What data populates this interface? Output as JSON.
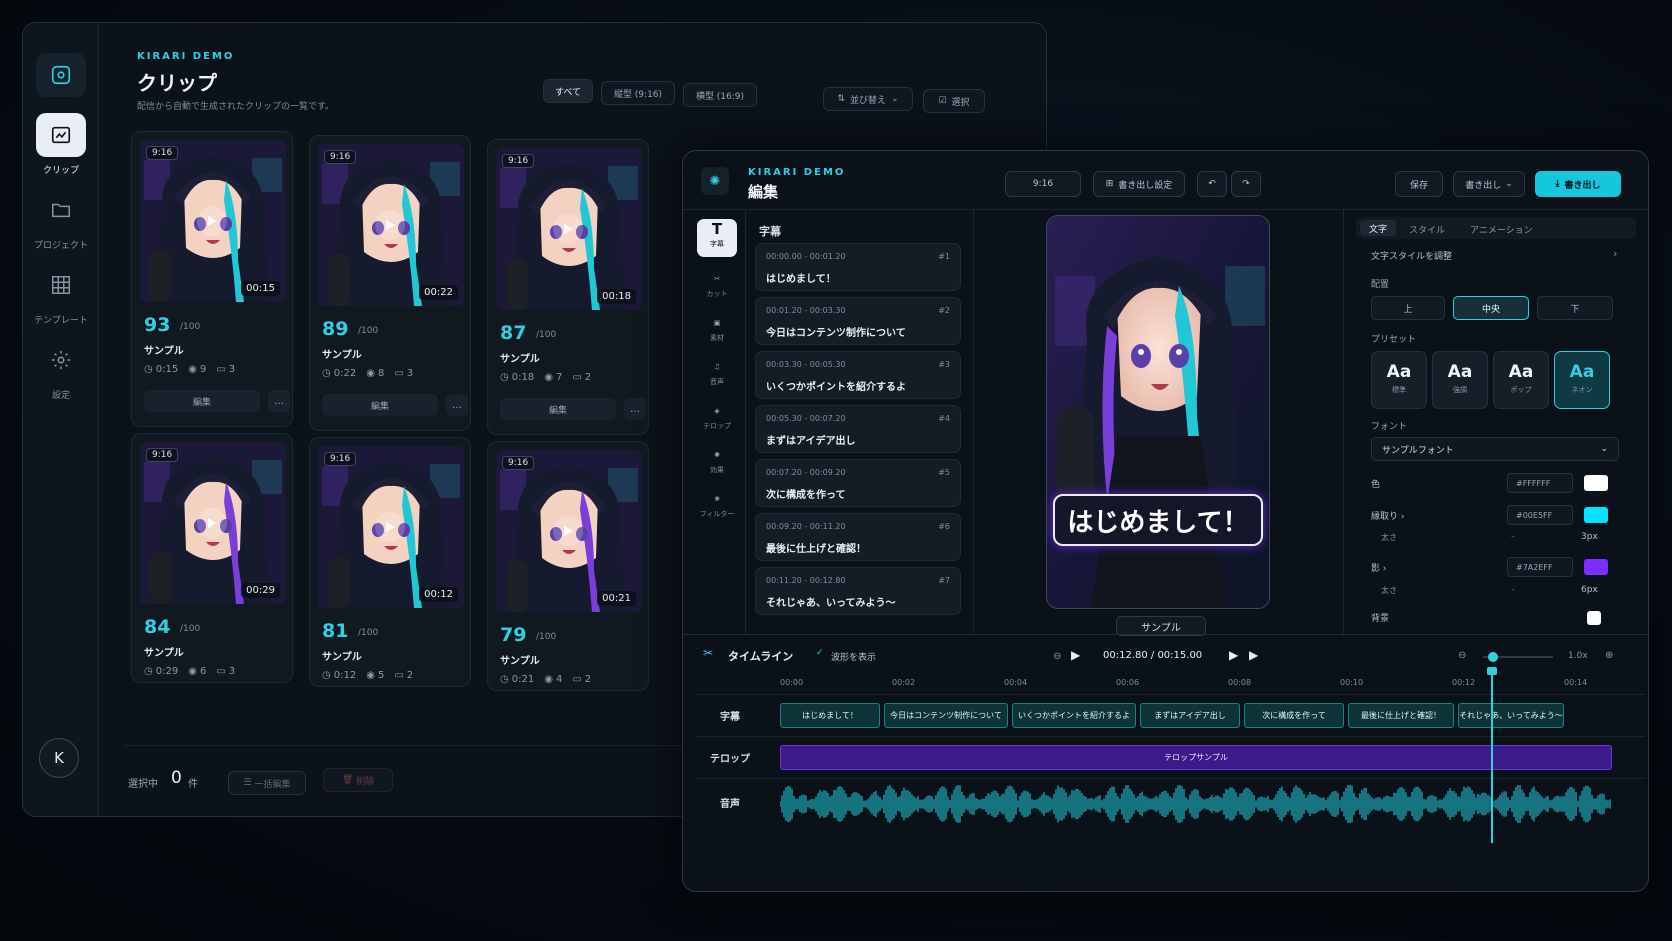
{
  "clips_window": {
    "brand": "KIRARI DEMO",
    "title": "クリップ",
    "subtitle": "配信から自動で生成されたクリップの一覧です。",
    "nav": [
      {
        "label": "クリップ",
        "icon": "clip-icon"
      },
      {
        "label": "プロジェクト",
        "icon": "folder-icon"
      },
      {
        "label": "テンプレート",
        "icon": "grid-icon"
      },
      {
        "label": "設定",
        "icon": "gear-icon"
      }
    ],
    "avatar": "K",
    "filters": [
      "すべて",
      "縦型 (9:16)",
      "横型 (16:9)"
    ],
    "sort_label": "並び替え",
    "select_label": "選択",
    "cards": [
      {
        "ratio": "9:16",
        "duration": "00:15",
        "score": "93",
        "max": "/100",
        "title": "サンプル",
        "time": "0:15",
        "views": "9",
        "comments": "3",
        "edit": "編集",
        "more": "…"
      },
      {
        "ratio": "9:16",
        "duration": "00:22",
        "score": "89",
        "max": "/100",
        "title": "サンプル",
        "time": "0:22",
        "views": "8",
        "comments": "3",
        "edit": "編集",
        "more": "…"
      },
      {
        "ratio": "9:16",
        "duration": "00:18",
        "score": "87",
        "max": "/100",
        "title": "サンプル",
        "time": "0:18",
        "views": "7",
        "comments": "2",
        "edit": "編集",
        "more": "…"
      },
      {
        "ratio": "9:16",
        "duration": "00:29",
        "score": "84",
        "max": "/100",
        "title": "サンプル",
        "time": "0:29",
        "views": "6",
        "comments": "3"
      },
      {
        "ratio": "9:16",
        "duration": "00:12",
        "score": "81",
        "max": "/100",
        "title": "サンプル",
        "time": "0:12",
        "views": "5",
        "comments": "2"
      },
      {
        "ratio": "9:16",
        "duration": "00:21",
        "score": "79",
        "max": "/100",
        "title": "サンプル",
        "time": "0:21",
        "views": "4",
        "comments": "2"
      }
    ],
    "footer": {
      "selected_label": "選択中",
      "count": "0",
      "unit": "件",
      "bulk_edit": "一括編集",
      "delete": "削除"
    }
  },
  "edit_window": {
    "brand": "KIRARI DEMO",
    "title": "編集",
    "ratio": "9:16",
    "export_settings": "書き出し設定",
    "save": "保存",
    "export_menu": "書き出し",
    "export_button": "書き出し",
    "tools": [
      {
        "label": "字幕",
        "icon": "text-icon"
      },
      {
        "label": "カット",
        "icon": "scissors-icon"
      },
      {
        "label": "素材",
        "icon": "media-icon"
      },
      {
        "label": "音声",
        "icon": "music-icon"
      },
      {
        "label": "テロップ",
        "icon": "layers-icon"
      },
      {
        "label": "効果",
        "icon": "sparkle-icon"
      },
      {
        "label": "フィルター",
        "icon": "filter-icon"
      }
    ],
    "subtitle_panel_title": "字幕",
    "subtitles": [
      {
        "time": "00:00.00 - 00:01.20",
        "num": "#1",
        "text": "はじめまして！"
      },
      {
        "time": "00:01.20 - 00:03.30",
        "num": "#2",
        "text": "今日はコンテンツ制作について"
      },
      {
        "time": "00:03.30 - 00:05.30",
        "num": "#3",
        "text": "いくつかポイントを紹介するよ"
      },
      {
        "time": "00:05.30 - 00:07.20",
        "num": "#4",
        "text": "まずはアイデア出し"
      },
      {
        "time": "00:07.20 - 00:09.20",
        "num": "#5",
        "text": "次に構成を作って"
      },
      {
        "time": "00:09.20 - 00:11.20",
        "num": "#6",
        "text": "最後に仕上げと確認！"
      },
      {
        "time": "00:11.20 - 00:12.80",
        "num": "#7",
        "text": "それじゃあ、いってみよう～"
      }
    ],
    "preview_caption": "はじめまして！",
    "preview_label": "サンプル",
    "props": {
      "tabs": [
        "文字",
        "スタイル",
        "アニメーション"
      ],
      "adjust": "文字スタイルを調整",
      "align_label": "配置",
      "align": [
        "上",
        "中央",
        "下"
      ],
      "preset_label": "プリセット",
      "presets": [
        {
          "aa": "Aa",
          "name": "標準"
        },
        {
          "aa": "Aa",
          "name": "強調"
        },
        {
          "aa": "Aa",
          "name": "ポップ"
        },
        {
          "aa": "Aa",
          "name": "ネオン"
        }
      ],
      "font_label": "フォント",
      "font": "サンプルフォント",
      "color_label": "色",
      "color": "#FFFFFF",
      "stroke_label": "縁取り",
      "stroke": "#00E5FF",
      "stroke_size_label": "太さ",
      "stroke_size": "3px",
      "shadow_label": "影",
      "shadow": "#7A2EFF",
      "shadow_size_label": "太さ",
      "shadow_size": "6px",
      "bg_label": "背景"
    },
    "timeline": {
      "title": "タイムライン",
      "waveform_toggle": "波形を表示",
      "current": "00:12.80 / 00:15.00",
      "zoom": "1.0x",
      "ticks": [
        "00:00",
        "00:02",
        "00:04",
        "00:06",
        "00:08",
        "00:10",
        "00:12",
        "00:14"
      ],
      "rows": [
        "字幕",
        "テロップ",
        "音声"
      ],
      "subtitle_clips": [
        "はじめまして！",
        "今日はコンテンツ制作について",
        "いくつかポイントを紹介するよ",
        "まずはアイデア出し",
        "次に構成を作って",
        "最後に仕上げと確認！",
        "それじゃあ、いってみよう～"
      ],
      "telop_clip": "テロップサンプル"
    }
  },
  "colors": {
    "accent": "#2fd0e0",
    "purple": "#7a2eff",
    "stroke": "#00e5ff"
  }
}
